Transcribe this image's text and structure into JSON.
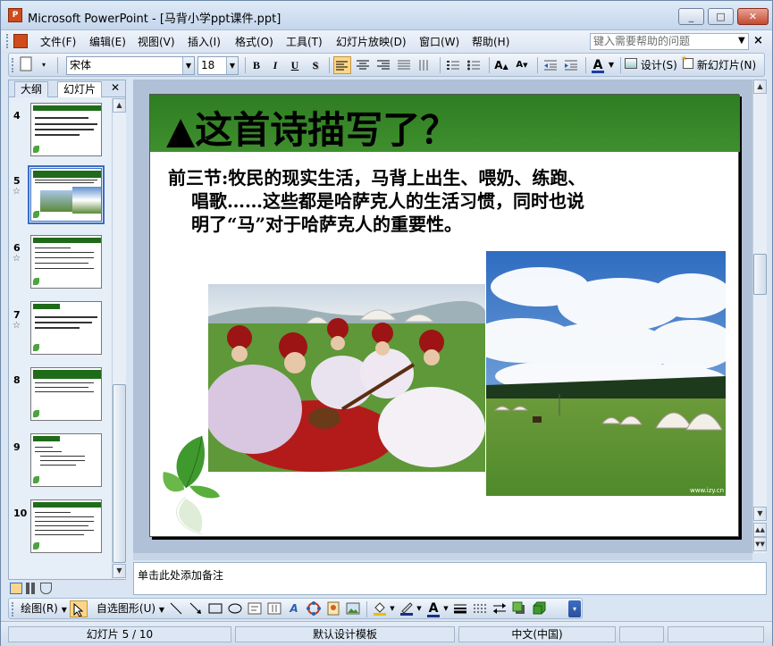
{
  "window": {
    "title": "Microsoft PowerPoint - [马背小学ppt课件.ppt]",
    "app_icon": "P",
    "minimize": "_",
    "maximize": "□",
    "close": "✕"
  },
  "menu": {
    "items": [
      "文件(F)",
      "编辑(E)",
      "视图(V)",
      "插入(I)",
      "格式(O)",
      "工具(T)",
      "幻灯片放映(D)",
      "窗口(W)",
      "帮助(H)"
    ],
    "help_placeholder": "键入需要帮助的问题",
    "close_glyph": "×"
  },
  "toolbar": {
    "font": "宋体",
    "size": "18",
    "bold": "B",
    "italic": "I",
    "underline": "U",
    "shadow": "S",
    "design_label": "设计(S)",
    "new_slide_label": "新幻灯片(N)"
  },
  "left_panel": {
    "tab_outline": "大纲",
    "tab_slides": "幻灯片",
    "close_glyph": "✕",
    "slide_numbers": [
      "4",
      "5",
      "6",
      "7",
      "8",
      "9",
      "10"
    ],
    "selected_slide": "5"
  },
  "slide": {
    "title": "▲这首诗描写了？",
    "body_label": "前三节:",
    "body_line1": "牧民的现实生活，马背上出生、喂奶、练跑、",
    "body_line2": "唱歌……这些都是哈萨克人的生活习惯，同时也说",
    "body_line3": "明了“马”对于哈萨克人的重要性。",
    "photo_credit": "www.izy.cn"
  },
  "notes": {
    "placeholder": "单击此处添加备注"
  },
  "drawing_toolbar": {
    "draw_label": "绘图(R)",
    "autoshape_label": "自选图形(U)"
  },
  "status": {
    "slide_pos": "幻灯片 5 / 10",
    "template": "默认设计模板",
    "language": "中文(中国)"
  },
  "colors": {
    "title_band": "#2e7d22",
    "window_bg": "#d9e5f3",
    "stage_bg": "#b0c0d6"
  }
}
